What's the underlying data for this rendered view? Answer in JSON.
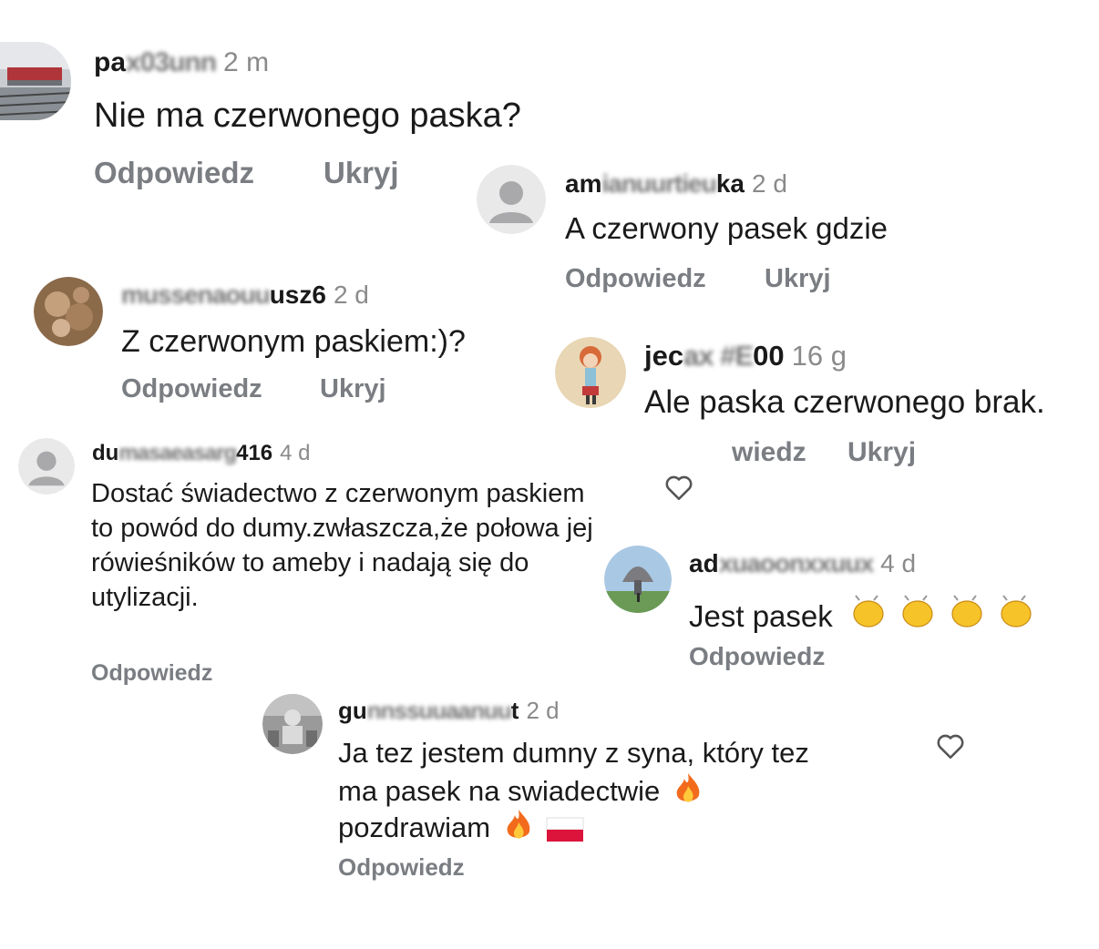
{
  "comments": [
    {
      "user_visible": "pa",
      "user_blurred": "x03unn",
      "time": "2 m",
      "text": "Nie ma czerwonego paska?",
      "reply": "Odpowiedz",
      "hide": "Ukryj"
    },
    {
      "user_visible": "am",
      "user_blurred": "ianuurtieu",
      "user_visible_end": "ka",
      "time": "2 d",
      "text": "A czerwony pasek gdzie",
      "reply": "Odpowiedz",
      "hide": "Ukryj"
    },
    {
      "user_blurred": "mussenaouu",
      "user_visible_end": "usz6",
      "time": "2 d",
      "text": "Z czerwonym paskiem:)?",
      "reply": "Odpowiedz",
      "hide": "Ukryj"
    },
    {
      "user_visible": "jec",
      "user_blurred": "ax #E",
      "user_visible_end": "00",
      "time": "16 g",
      "text": "Ale paska czerwonego brak.",
      "reply": "wiedz",
      "hide": "Ukryj"
    },
    {
      "user_visible": "du",
      "user_blurred": "masaeasarg",
      "user_visible_end": "416",
      "time": "4 d",
      "text": "Dostać świadectwo z czerwonym paskiem to powód do dumy.zwłaszcza,że połowa jej rówieśników to ameby i nadają się do utylizacji.",
      "reply": "Odpowiedz"
    },
    {
      "user_visible": "ad",
      "user_blurred": "xuaoonxxuux",
      "time": "4 d",
      "text": "Jest pasek",
      "reply": "Odpowiedz"
    },
    {
      "user_visible": "gu",
      "user_blurred": "nnssuuaanuu",
      "user_visible_end": "t",
      "time": "2 d",
      "text_line1": "Ja tez jestem dumny z syna, który tez",
      "text_line2": "ma pasek na swiadectwie",
      "text_line3": "pozdrawiam",
      "reply": "Odpowiedz"
    }
  ],
  "icons": {
    "heart": "heart-outline-icon",
    "clap": "clapping-hands-emoji",
    "fire": "fire-emoji",
    "flag": "poland-flag-emoji",
    "default_avatar": "default-avatar-icon"
  },
  "colors": {
    "action_text": "#7a7d82",
    "timestamp": "#8a8a8a",
    "default_avatar_bg": "#dcdcdc",
    "default_avatar_fg": "#a5a5a5"
  }
}
